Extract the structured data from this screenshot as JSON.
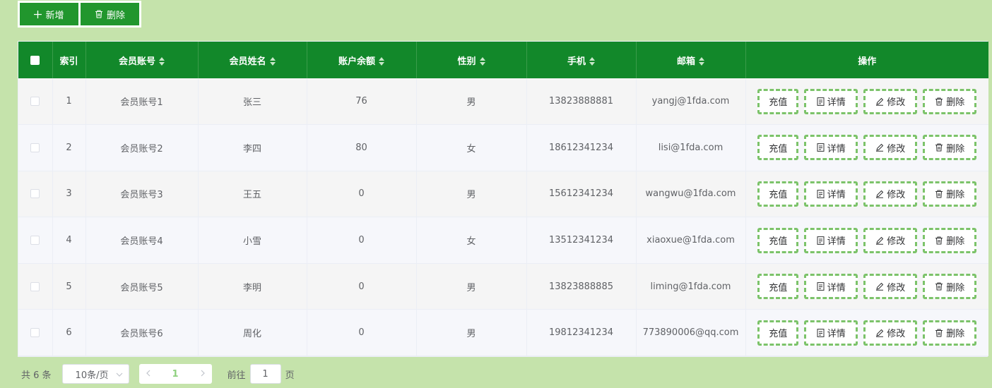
{
  "toolbar": {
    "add_label": "新增",
    "delete_label": "删除"
  },
  "table": {
    "headers": {
      "index": "索引",
      "account": "会员账号",
      "name": "会员姓名",
      "balance": "账户余额",
      "gender": "性别",
      "phone": "手机",
      "email": "邮箱",
      "ops": "操作"
    },
    "rows": [
      {
        "index": "1",
        "account": "会员账号1",
        "name": "张三",
        "balance": "76",
        "gender": "男",
        "phone": "13823888881",
        "email": "yangj@1fda.com"
      },
      {
        "index": "2",
        "account": "会员账号2",
        "name": "李四",
        "balance": "80",
        "gender": "女",
        "phone": "18612341234",
        "email": "lisi@1fda.com"
      },
      {
        "index": "3",
        "account": "会员账号3",
        "name": "王五",
        "balance": "0",
        "gender": "男",
        "phone": "15612341234",
        "email": "wangwu@1fda.com"
      },
      {
        "index": "4",
        "account": "会员账号4",
        "name": "小雪",
        "balance": "0",
        "gender": "女",
        "phone": "13512341234",
        "email": "xiaoxue@1fda.com"
      },
      {
        "index": "5",
        "account": "会员账号5",
        "name": "李明",
        "balance": "0",
        "gender": "男",
        "phone": "13823888885",
        "email": "liming@1fda.com"
      },
      {
        "index": "6",
        "account": "会员账号6",
        "name": "周化",
        "balance": "0",
        "gender": "男",
        "phone": "19812341234",
        "email": "773890006@qq.com"
      }
    ],
    "row_actions": {
      "recharge": "充值",
      "detail": "详情",
      "edit": "修改",
      "delete": "删除"
    }
  },
  "pagination": {
    "total_text": "共 6 条",
    "page_size": "10条/页",
    "current_page": "1",
    "goto_label": "前往",
    "goto_value": "1",
    "page_unit": "页"
  },
  "colors": {
    "page_bg": "#c5e3ab",
    "header_bg": "#12882a",
    "toolbar_btn": "#21962d",
    "dashed_border": "#7cc36a"
  }
}
